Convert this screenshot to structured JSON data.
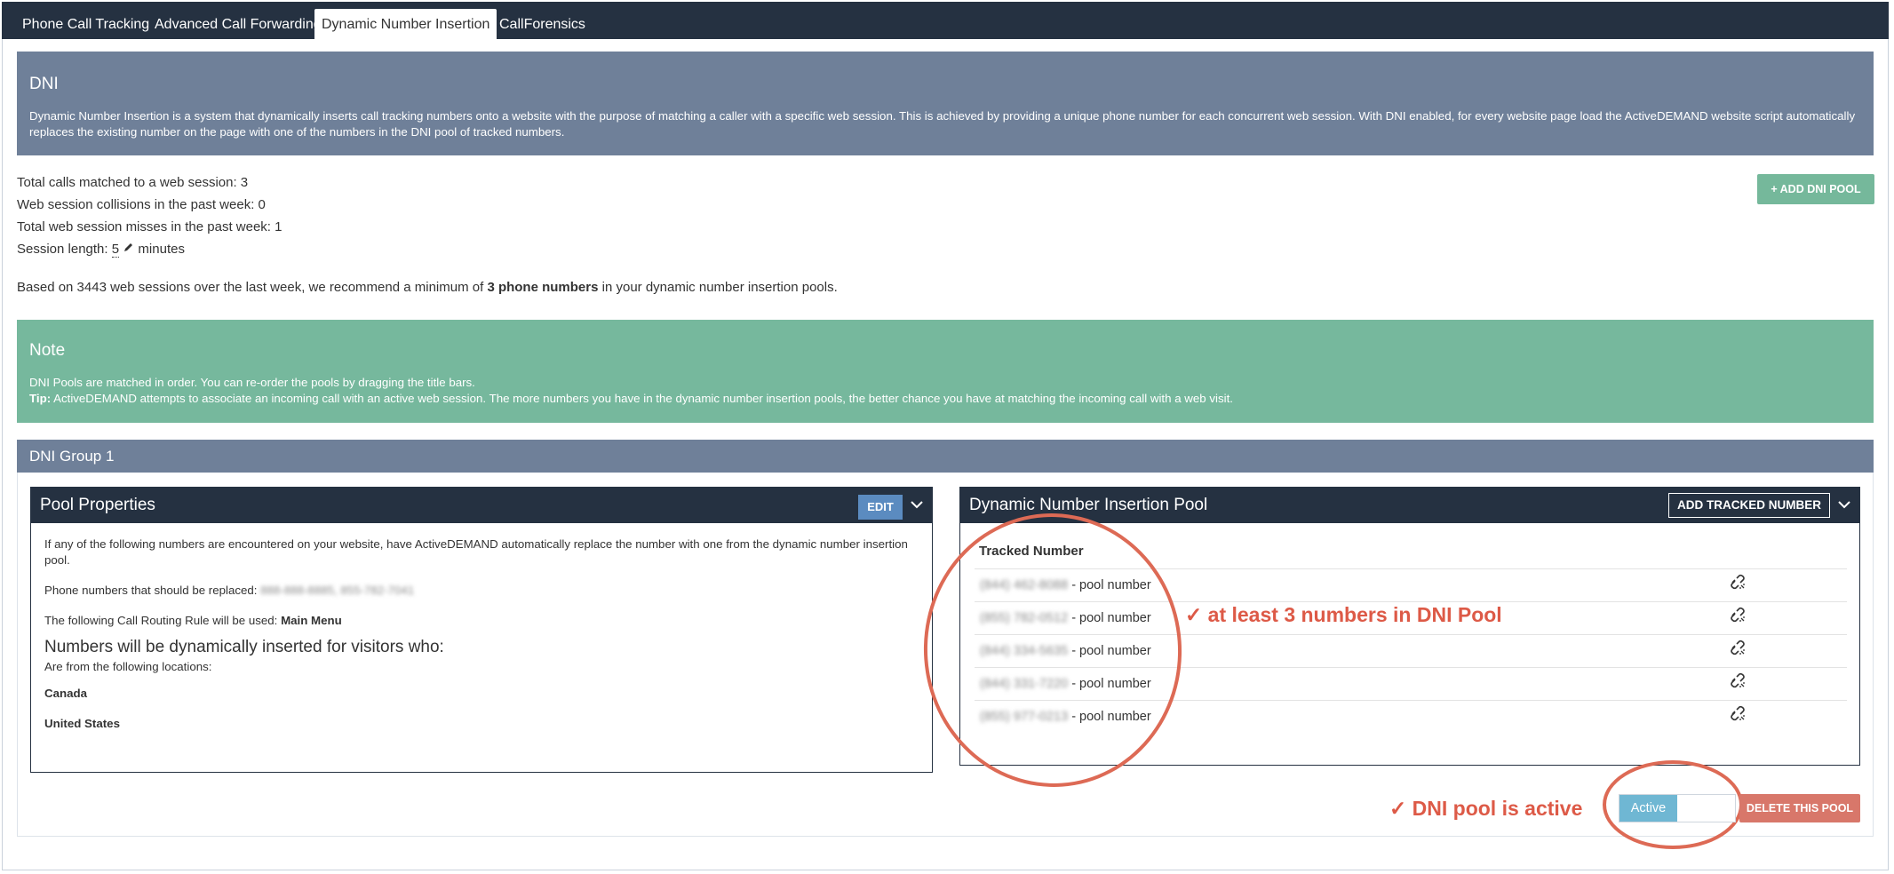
{
  "tabs": [
    {
      "label": "Phone Call Tracking"
    },
    {
      "label": "Advanced Call Forwarding"
    },
    {
      "label": "Dynamic Number Insertion"
    },
    {
      "label": "CallForensics"
    }
  ],
  "dni": {
    "title": "DNI",
    "description": "Dynamic Number Insertion is a system that dynamically inserts call tracking numbers onto a website with the purpose of matching a caller with a specific web session. This is achieved by providing a unique phone number for each concurrent web session. With DNI enabled, for every website page load the ActiveDEMAND website script automatically replaces the existing number on the page with one of the numbers in the DNI pool of tracked numbers."
  },
  "stats": {
    "total_calls": "Total calls matched to a web session: 3",
    "collisions": "Web session collisions in the past week: 0",
    "misses": "Total web session misses in the past week: 1",
    "session_prefix": "Session length: ",
    "session_value": "5",
    "session_suffix": " minutes"
  },
  "recommend": {
    "prefix": "Based on 3443 web sessions over the last week, we recommend a minimum of ",
    "bold": "3 phone numbers",
    "suffix": " in your dynamic number insertion pools."
  },
  "add_pool_label": "+ ADD DNI POOL",
  "note": {
    "title": "Note",
    "line1": "DNI Pools are matched in order. You can re-order the pools by dragging the title bars.",
    "tip_label": "Tip:",
    "tip_text": " ActiveDEMAND attempts to associate an incoming call with an active web session. The more numbers you have in the dynamic number insertion pools, the better chance you have at matching the incoming call with a web visit."
  },
  "group_title": "DNI Group 1",
  "pool_properties": {
    "title": "Pool Properties",
    "edit_label": "EDIT",
    "intro": "If any of the following numbers are encountered on your website, have ActiveDEMAND automatically replace the number with one from the dynamic number insertion pool.",
    "replaced_label": "Phone numbers that should be replaced: ",
    "replaced_value": "888-888-8885, 855-782-7041",
    "routing_label": "The following Call Routing Rule will be used: ",
    "routing_value": "Main Menu",
    "visitors_heading": "Numbers will be dynamically inserted for visitors who:",
    "locations_label": "Are from the following locations:",
    "locations": [
      "Canada",
      "United States"
    ]
  },
  "dni_pool": {
    "title": "Dynamic Number Insertion Pool",
    "add_tracked_label": "ADD TRACKED NUMBER",
    "column_header": "Tracked Number",
    "rows": [
      {
        "number": "(844) 462-8088",
        "suffix": " - pool number"
      },
      {
        "number": "(855) 782-0512",
        "suffix": " - pool number"
      },
      {
        "number": "(844) 334-5635",
        "suffix": " - pool number"
      },
      {
        "number": "(844) 331-7220",
        "suffix": " - pool number"
      },
      {
        "number": "(855) 977-0213",
        "suffix": " - pool number"
      }
    ]
  },
  "annotations": {
    "numbers": "✓ at least 3 numbers in DNI Pool",
    "active": "✓ DNI pool is active",
    "color": "#dd5a47"
  },
  "toggle_label": "Active",
  "delete_label": "DELETE THIS POOL",
  "colors": {
    "navy": "#253141",
    "slate": "#6f8099",
    "green": "#76b89d",
    "edit_blue": "#5b8bc0",
    "toggle_blue": "#6fb7d3",
    "delete_red": "#d8776a"
  }
}
